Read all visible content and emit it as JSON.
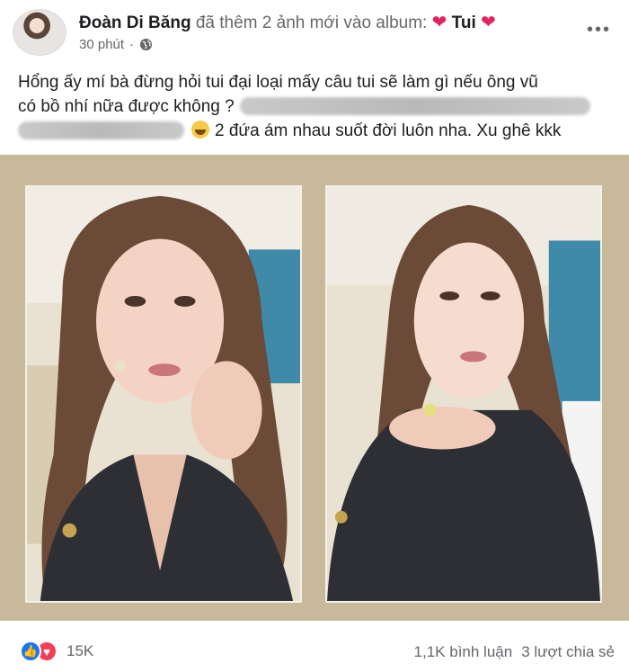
{
  "post": {
    "author": "Đoàn Di Băng",
    "action": "đã thêm 2 ảnh mới vào album:",
    "album_name": "Tui",
    "heart": "❤",
    "time": "30 phút",
    "more": "•••",
    "text_line1": "Hổng ấy mí bà đừng hỏi tui đại loại mấy câu tui sẽ làm gì nếu ông vũ",
    "text_line2": "có bồ nhí nữa được không ?",
    "text_line3": "2 đứa ám nhau suốt đời luôn nha. Xu ghê  kkk"
  },
  "footer": {
    "reaction_count": "15K",
    "comments": "1,1K bình luận",
    "shares": "3 lượt chia sẻ"
  },
  "colors": {
    "photo_background": "#c7b99a",
    "like": "#1877f2",
    "love": "#f33e58",
    "heart": "#e0245e"
  },
  "icons": [
    "globe-icon",
    "more-icon",
    "like-icon",
    "love-icon",
    "emoji-icon"
  ]
}
